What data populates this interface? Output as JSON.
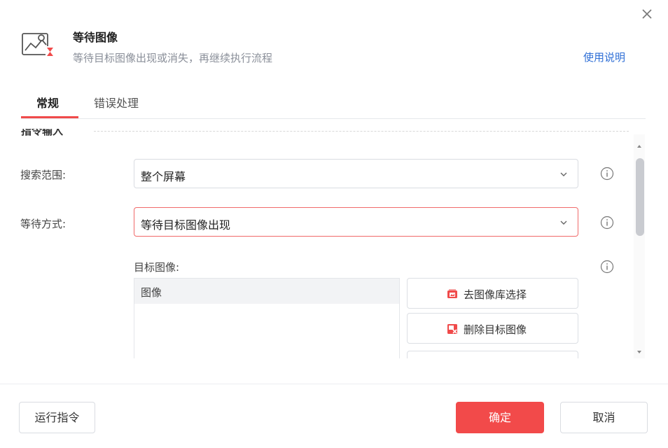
{
  "header": {
    "title": "等待图像",
    "subtitle": "等待目标图像出现或消失，再继续执行流程",
    "help_link": "使用说明"
  },
  "tabs": [
    {
      "label": "常规",
      "active": true
    },
    {
      "label": "错误处理",
      "active": false
    }
  ],
  "section": {
    "title": "指令输入"
  },
  "fields": {
    "search_range": {
      "label": "搜索范围:",
      "value": "整个屏幕"
    },
    "wait_mode": {
      "label": "等待方式:",
      "value": "等待目标图像出现"
    },
    "target_image": {
      "label": "目标图像:",
      "list_header": "图像",
      "buttons": [
        "去图像库选择",
        "删除目标图像"
      ]
    }
  },
  "footer": {
    "run": "运行指令",
    "ok": "确定",
    "cancel": "取消"
  },
  "colors": {
    "accent": "#f24a4a",
    "link": "#2f6fd6",
    "muted": "#8a8f99"
  },
  "icons": [
    "close-icon",
    "wait-image-icon",
    "info-icon",
    "chevron-down-icon",
    "image-library-icon",
    "delete-image-icon"
  ]
}
